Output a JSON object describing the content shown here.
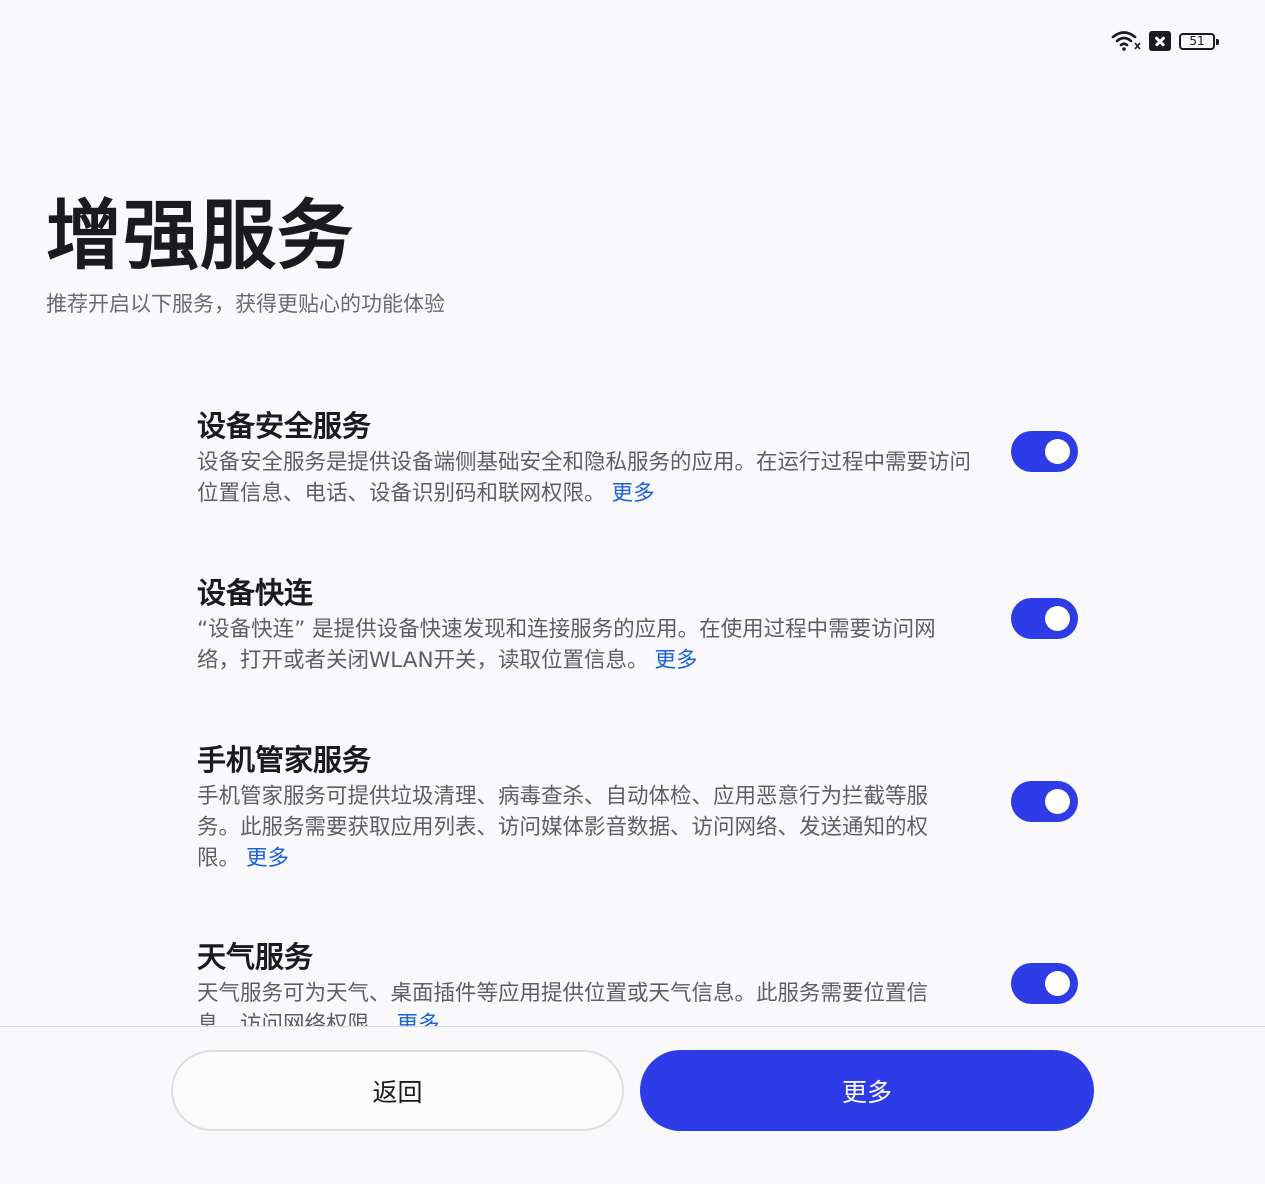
{
  "status_bar": {
    "battery_level": "51",
    "icons": [
      "wifi-icon",
      "no-sim-icon",
      "battery-icon"
    ]
  },
  "header": {
    "title": "增强服务",
    "subtitle": "推荐开启以下服务，获得更贴心的功能体验"
  },
  "services": [
    {
      "name": "设备安全服务",
      "description": "设备安全服务是提供设备端侧基础安全和隐私服务的应用。在运行过程中需要访问位置信息、电话、设备识别码和联网权限。",
      "more_label": "更多",
      "enabled": true
    },
    {
      "name": "设备快连",
      "description": "“设备快连” 是提供设备快速发现和连接服务的应用。在使用过程中需要访问网络，打开或者关闭WLAN开关，读取位置信息。",
      "more_label": "更多",
      "enabled": true
    },
    {
      "name": "手机管家服务",
      "description": "手机管家服务可提供垃圾清理、病毒查杀、自动体检、应用恶意行为拦截等服务。此服务需要获取应用列表、访问媒体影音数据、访问网络、发送通知的权限。",
      "more_label": "更多",
      "enabled": true
    },
    {
      "name": "天气服务",
      "description": "天气服务可为天气、桌面插件等应用提供位置或天气信息。此服务需要位置信息、访问网络权限。",
      "more_label": "更多",
      "enabled": true
    }
  ],
  "footer": {
    "back_label": "返回",
    "more_label": "更多"
  },
  "colors": {
    "accent": "#2d3ce6",
    "link": "#1d63d8",
    "background": "#f9f8fa"
  }
}
